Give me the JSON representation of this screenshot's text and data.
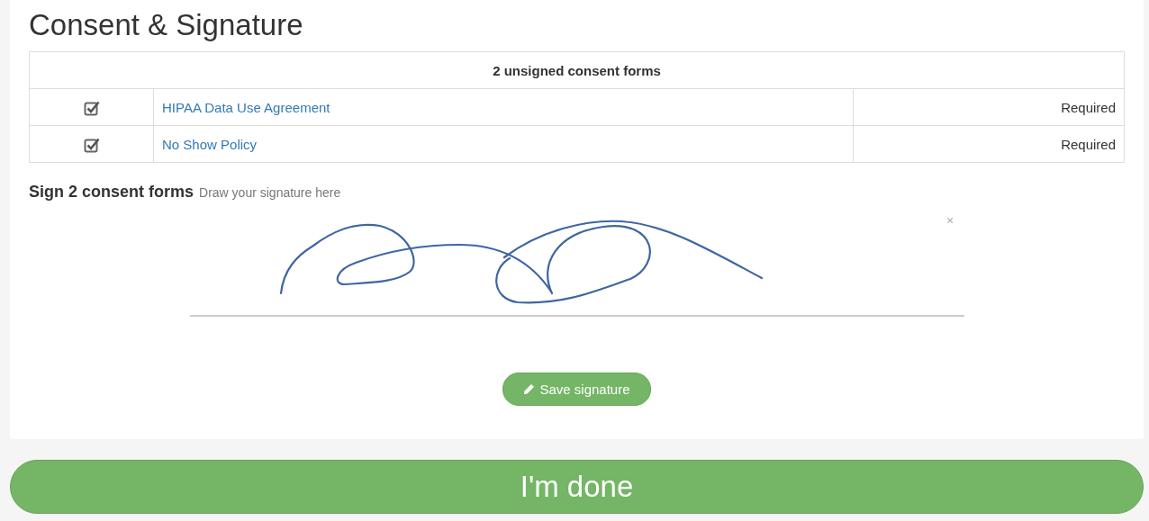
{
  "title": "Consent & Signature",
  "table": {
    "header": "2 unsigned consent forms",
    "rows": [
      {
        "checked": true,
        "name": "HIPAA Data Use Agreement",
        "status": "Required"
      },
      {
        "checked": true,
        "name": "No Show Policy",
        "status": "Required"
      }
    ]
  },
  "signature": {
    "heading": "Sign 2 consent forms",
    "hint": "Draw your signature here",
    "clear": "×",
    "save": "Save signature"
  },
  "done": "I'm done"
}
